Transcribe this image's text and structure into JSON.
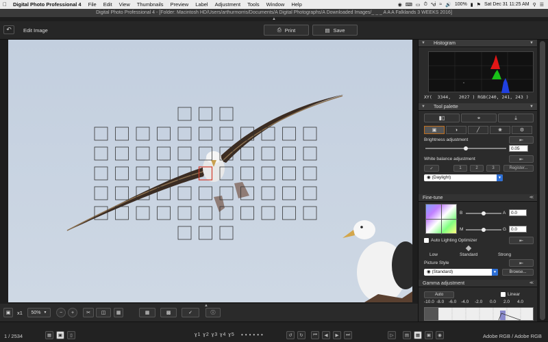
{
  "menubar": {
    "app": "Digital Photo Professional 4",
    "items": [
      "File",
      "Edit",
      "View",
      "Thumbnails",
      "Preview",
      "Label",
      "Adjustment",
      "Tools",
      "Window",
      "Help"
    ],
    "battery": "100%",
    "clock": "Sat Dec 31  11:25 AM"
  },
  "window": {
    "title": "Digital Photo Professional 4 - [Folder: Macintosh HD/Users/arthurmorris/Documents/A Digital Photographs/A Downloaded Images/_ _ _ A A A Falklands 3 WEEKS 2016]"
  },
  "toolbar": {
    "edit_title": "Edit Image",
    "print_label": "Print",
    "save_label": "Save"
  },
  "viewer": {
    "af_grid": {
      "columns": 11,
      "rows": 5,
      "active_point": "center"
    }
  },
  "bottombar": {
    "zoom_x": "x1",
    "zoom_level": "50%"
  },
  "statusbar": {
    "counter": "1 / 2534",
    "ratings": "ɣ1 ɣ2 ɣ3 ɣ4 ɣ5",
    "dots": "••••••",
    "colorspace": "Adobe RGB / Adobe RGB"
  },
  "histogram": {
    "title": "Histogram",
    "xy_label": "XY(  3344,   2027 )",
    "rgb_label": "RGB(240, 241, 243 )"
  },
  "tool_palette": {
    "title": "Tool palette",
    "brightness": {
      "label": "Brightness adjustment",
      "value": "0.05"
    },
    "white_balance": {
      "label": "White balance adjustment",
      "buttons": [
        "1",
        "2",
        "3"
      ],
      "register": "Register...",
      "selected": "(Daylight)"
    },
    "fine_tune": {
      "title": "Fine-tune",
      "b_label": "B",
      "a_label": "A",
      "m_label": "M",
      "g_label": "G",
      "a_value": "0.0",
      "g_value": "0.0"
    },
    "alo": {
      "label": "Auto Lighting Optimizer",
      "low": "Low",
      "standard": "Standard",
      "strong": "Strong"
    },
    "picture_style": {
      "label": "Picture Style",
      "selected": "(Standard)",
      "browse": "Browse..."
    },
    "gamma": {
      "title": "Gamma adjustment",
      "auto": "Auto",
      "linear": "Linear",
      "scale": [
        "-10.0",
        "-8.0",
        "-6.0",
        "-4.0",
        "-2.0",
        "0.0",
        "2.0",
        "4.0"
      ]
    }
  },
  "colors": {
    "accent": "#c07020",
    "sky": "#c9d4e2",
    "select_blue": "#2d6fd6"
  }
}
